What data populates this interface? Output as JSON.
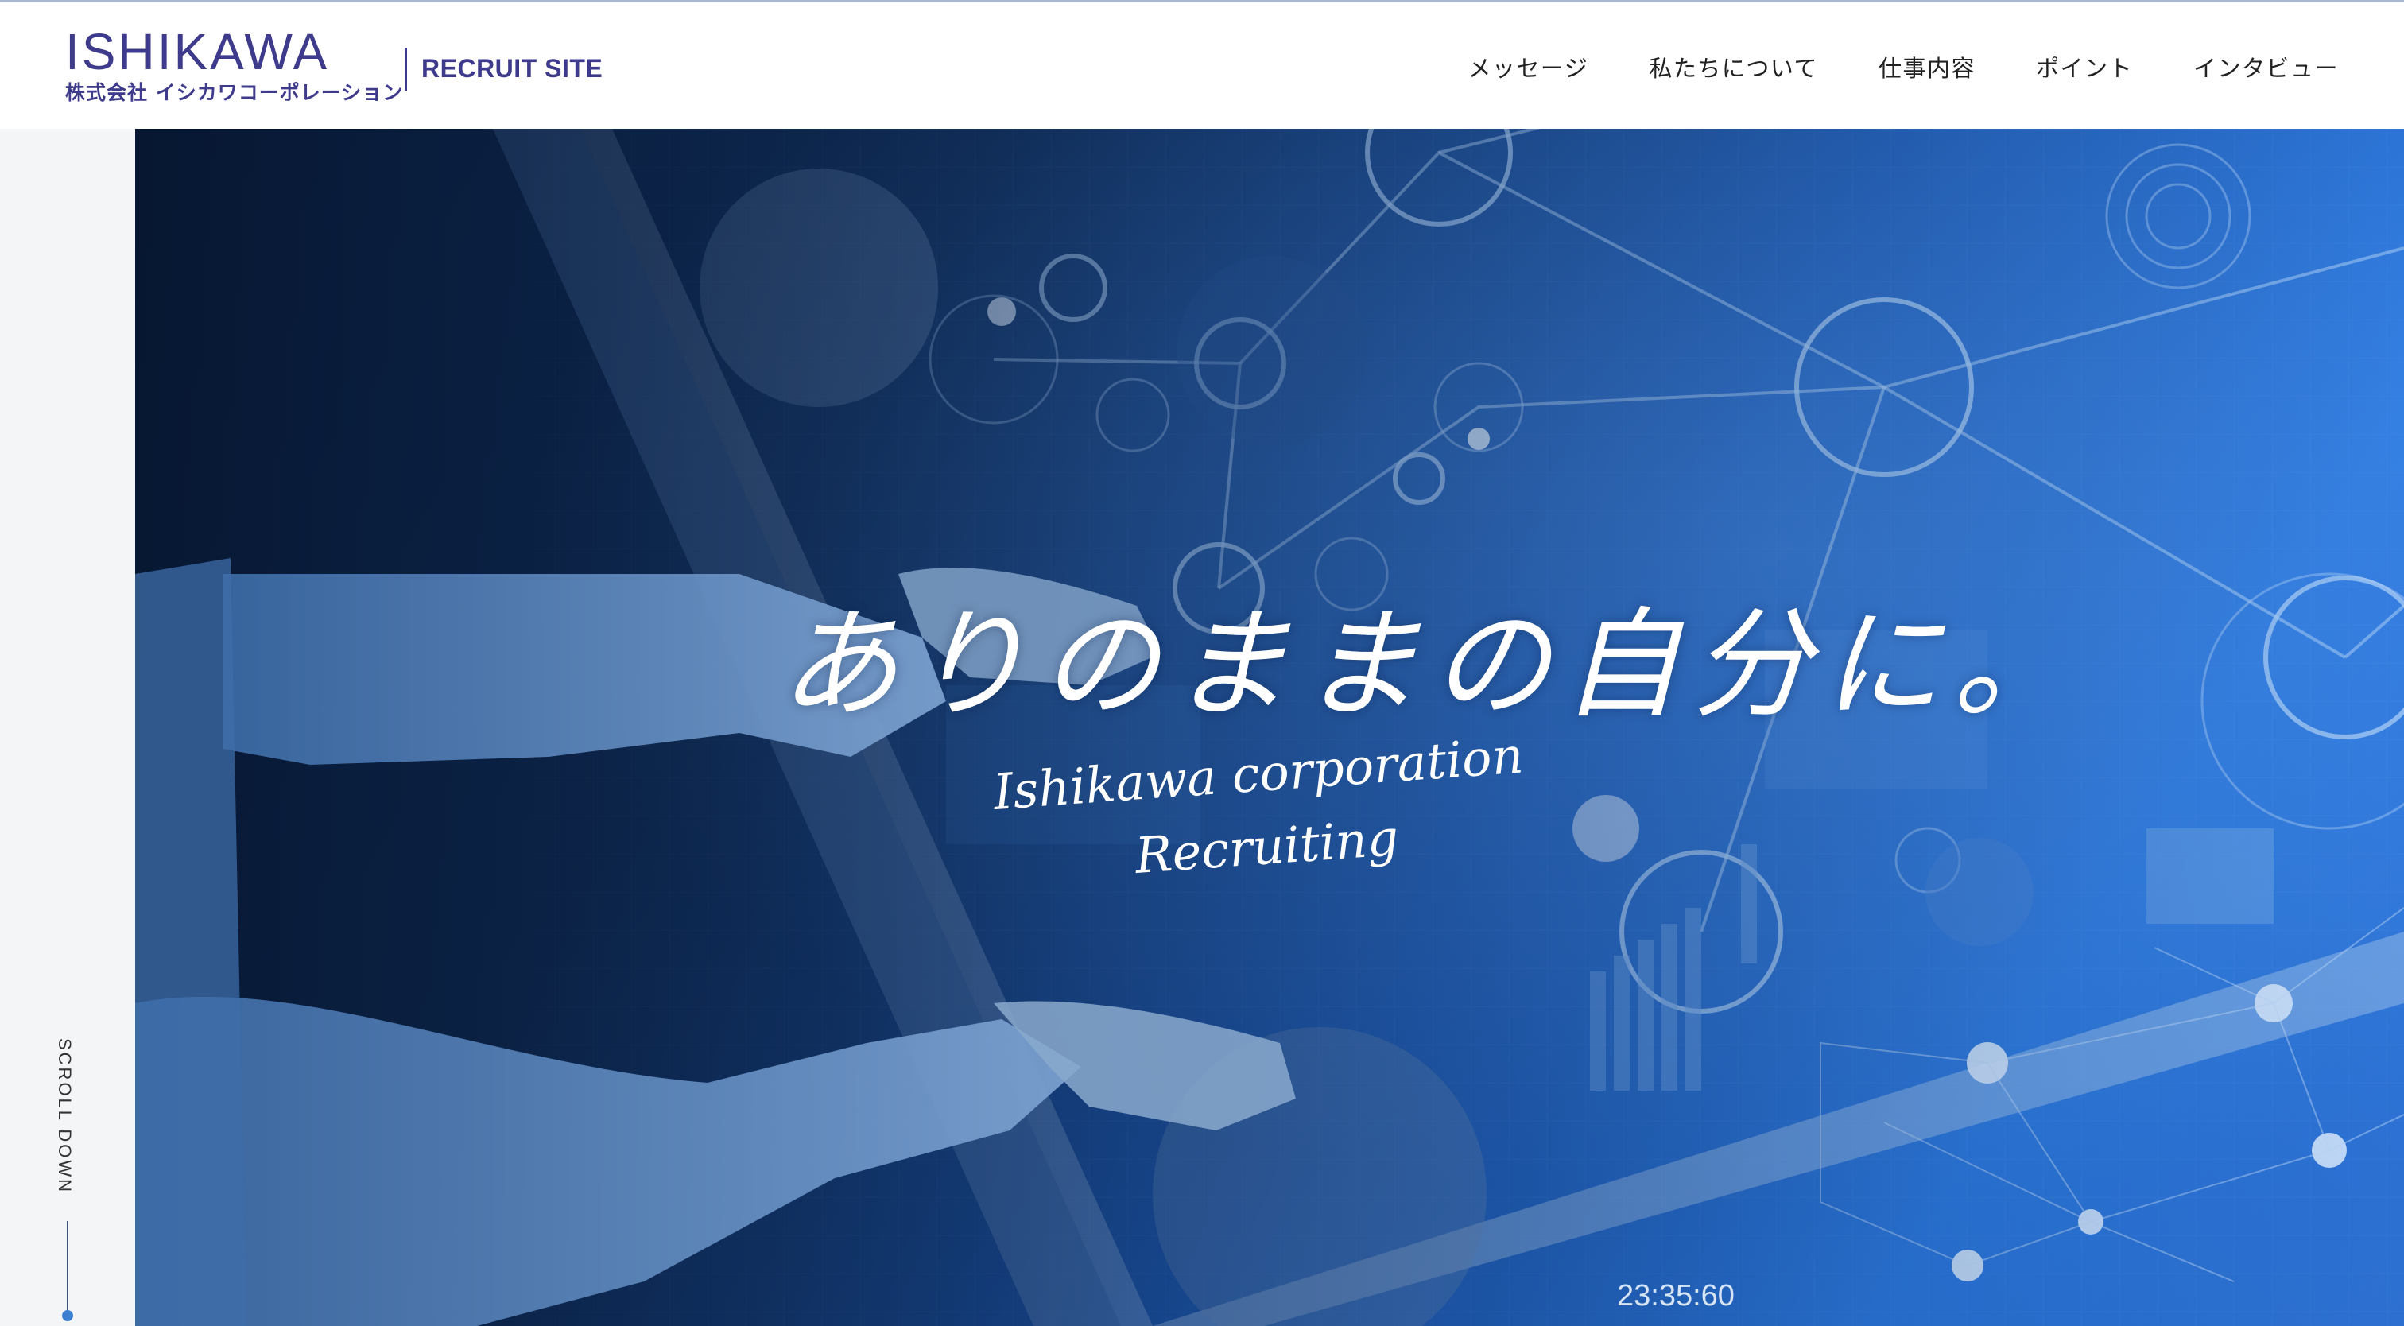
{
  "header": {
    "logo": {
      "main": "ISHIKAWA",
      "sub": "株式会社 イシカワコーポレーション"
    },
    "site_label": "RECRUIT SITE",
    "nav": [
      {
        "label": "メッセージ"
      },
      {
        "label": "私たちについて"
      },
      {
        "label": "仕事内容"
      },
      {
        "label": "ポイント"
      },
      {
        "label": "インタビュー"
      }
    ]
  },
  "side": {
    "scroll_label": "SCROLL DOWN"
  },
  "hero": {
    "title": "ありのままの自分に。",
    "subtitle_line1": "Ishikawa corporation",
    "subtitle_line2": "Recruiting",
    "clock": "23:35:60"
  },
  "colors": {
    "brand": "#3e3a8c",
    "scroll_dot": "#3c7fd1",
    "hero_dark": "#0b2247",
    "hero_light": "#2b78de"
  },
  "icons": {
    "scroll_indicator": "scroll-dot-icon"
  }
}
